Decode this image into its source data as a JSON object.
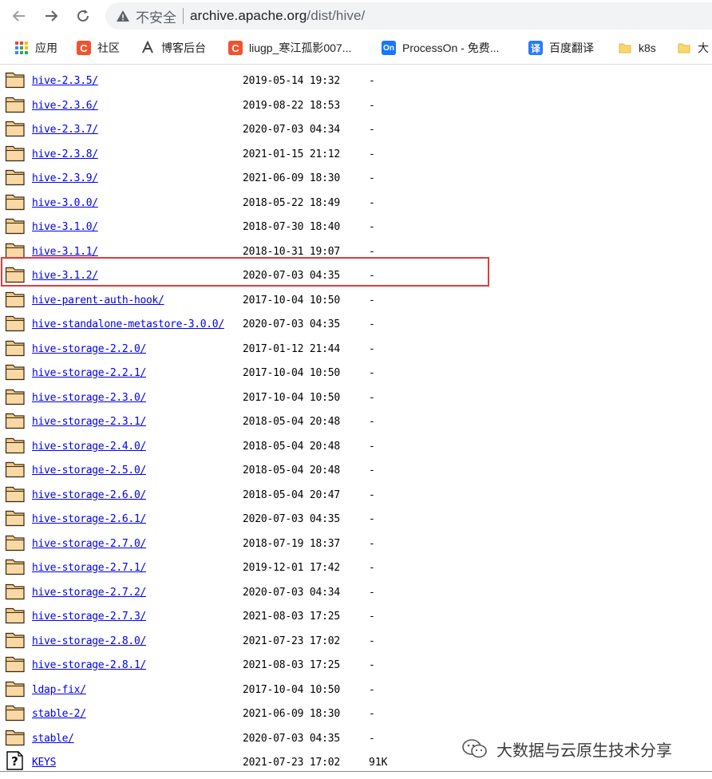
{
  "browser": {
    "security_label": "不安全",
    "url_host": "archive.apache.org",
    "url_path": "/dist/hive/"
  },
  "bookmarks": [
    {
      "label": "应用",
      "icon": "apps-grid-icon"
    },
    {
      "label": "社区",
      "icon": "csdn-c-icon"
    },
    {
      "label": "博客后台",
      "icon": "blog-admin-icon"
    },
    {
      "label": "liugp_寒江孤影007...",
      "icon": "csdn-c-icon"
    },
    {
      "label": "ProcessOn - 免费...",
      "icon": "processon-icon"
    },
    {
      "label": "百度翻译",
      "icon": "baidu-translate-icon"
    },
    {
      "label": "k8s",
      "icon": "folder-icon"
    },
    {
      "label": "大",
      "icon": "folder-icon"
    }
  ],
  "rows": [
    {
      "name": "hive-2.3.5/",
      "date": "2019-05-14 19:32",
      "size": "-",
      "icon": "folder-icon"
    },
    {
      "name": "hive-2.3.6/",
      "date": "2019-08-22 18:53",
      "size": "-",
      "icon": "folder-icon"
    },
    {
      "name": "hive-2.3.7/",
      "date": "2020-07-03 04:34",
      "size": "-",
      "icon": "folder-icon"
    },
    {
      "name": "hive-2.3.8/",
      "date": "2021-01-15 21:12",
      "size": "-",
      "icon": "folder-icon"
    },
    {
      "name": "hive-2.3.9/",
      "date": "2021-06-09 18:30",
      "size": "-",
      "icon": "folder-icon"
    },
    {
      "name": "hive-3.0.0/",
      "date": "2018-05-22 18:49",
      "size": "-",
      "icon": "folder-icon"
    },
    {
      "name": "hive-3.1.0/",
      "date": "2018-07-30 18:40",
      "size": "-",
      "icon": "folder-icon"
    },
    {
      "name": "hive-3.1.1/",
      "date": "2018-10-31 19:07",
      "size": "-",
      "icon": "folder-icon"
    },
    {
      "name": "hive-3.1.2/",
      "date": "2020-07-03 04:35",
      "size": "-",
      "icon": "folder-icon"
    },
    {
      "name": "hive-parent-auth-hook/",
      "date": "2017-10-04 10:50",
      "size": "-",
      "icon": "folder-icon"
    },
    {
      "name": "hive-standalone-metastore-3.0.0/",
      "date": "2020-07-03 04:35",
      "size": "-",
      "icon": "folder-icon"
    },
    {
      "name": "hive-storage-2.2.0/",
      "date": "2017-01-12 21:44",
      "size": "-",
      "icon": "folder-icon"
    },
    {
      "name": "hive-storage-2.2.1/",
      "date": "2017-10-04 10:50",
      "size": "-",
      "icon": "folder-icon"
    },
    {
      "name": "hive-storage-2.3.0/",
      "date": "2017-10-04 10:50",
      "size": "-",
      "icon": "folder-icon"
    },
    {
      "name": "hive-storage-2.3.1/",
      "date": "2018-05-04 20:48",
      "size": "-",
      "icon": "folder-icon"
    },
    {
      "name": "hive-storage-2.4.0/",
      "date": "2018-05-04 20:48",
      "size": "-",
      "icon": "folder-icon"
    },
    {
      "name": "hive-storage-2.5.0/",
      "date": "2018-05-04 20:48",
      "size": "-",
      "icon": "folder-icon"
    },
    {
      "name": "hive-storage-2.6.0/",
      "date": "2018-05-04 20:47",
      "size": "-",
      "icon": "folder-icon"
    },
    {
      "name": "hive-storage-2.6.1/",
      "date": "2020-07-03 04:35",
      "size": "-",
      "icon": "folder-icon"
    },
    {
      "name": "hive-storage-2.7.0/",
      "date": "2018-07-19 18:37",
      "size": "-",
      "icon": "folder-icon"
    },
    {
      "name": "hive-storage-2.7.1/",
      "date": "2019-12-01 17:42",
      "size": "-",
      "icon": "folder-icon"
    },
    {
      "name": "hive-storage-2.7.2/",
      "date": "2020-07-03 04:34",
      "size": "-",
      "icon": "folder-icon"
    },
    {
      "name": "hive-storage-2.7.3/",
      "date": "2021-08-03 17:25",
      "size": "-",
      "icon": "folder-icon"
    },
    {
      "name": "hive-storage-2.8.0/",
      "date": "2021-07-23 17:02",
      "size": "-",
      "icon": "folder-icon"
    },
    {
      "name": "hive-storage-2.8.1/",
      "date": "2021-08-03 17:25",
      "size": "-",
      "icon": "folder-icon"
    },
    {
      "name": "ldap-fix/",
      "date": "2017-10-04 10:50",
      "size": "-",
      "icon": "folder-icon"
    },
    {
      "name": "stable-2/",
      "date": "2021-06-09 18:30",
      "size": "-",
      "icon": "folder-icon"
    },
    {
      "name": "stable/",
      "date": "2020-07-03 04:35",
      "size": "-",
      "icon": "folder-icon"
    },
    {
      "name": "KEYS",
      "date": "2021-07-23 17:02",
      "size": "91K",
      "icon": "unknown-file-icon"
    }
  ],
  "highlighted_row": "hive-3.1.2/",
  "watermark": "大数据与云原生技术分享",
  "colors": {
    "link": "#0000ee",
    "highlight_border": "#e03b3b",
    "folder_fill": "#f3c98b"
  }
}
